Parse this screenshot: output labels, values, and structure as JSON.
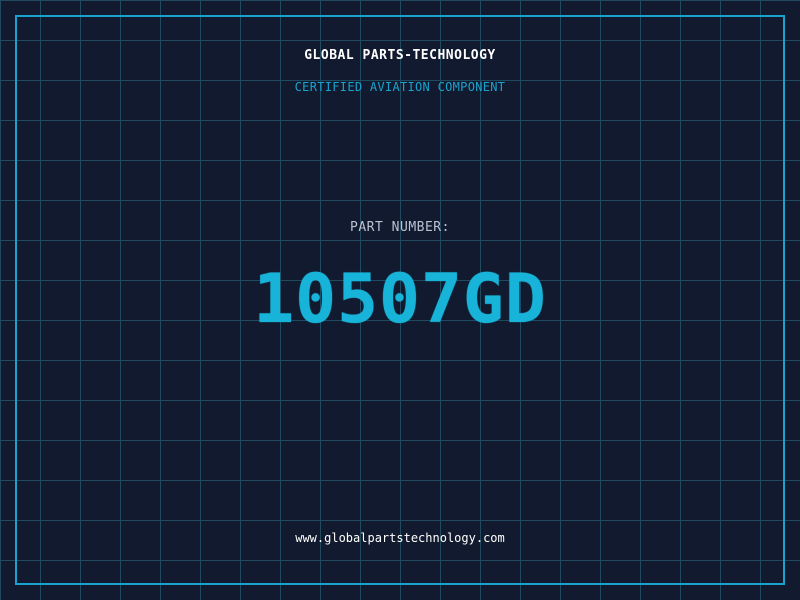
{
  "header": {
    "company": "GLOBAL PARTS-TECHNOLOGY",
    "subtitle": "CERTIFIED AVIATION COMPONENT"
  },
  "part": {
    "label": "PART NUMBER:",
    "number": "10507GD"
  },
  "footer": {
    "website": "www.globalpartstechnology.com"
  },
  "colors": {
    "background": "#111a2e",
    "grid": "#1f4a60",
    "accent": "#1aa2cf",
    "part_number": "#18b3d8",
    "text_primary": "#ffffff",
    "text_muted": "#b9c3d2"
  }
}
